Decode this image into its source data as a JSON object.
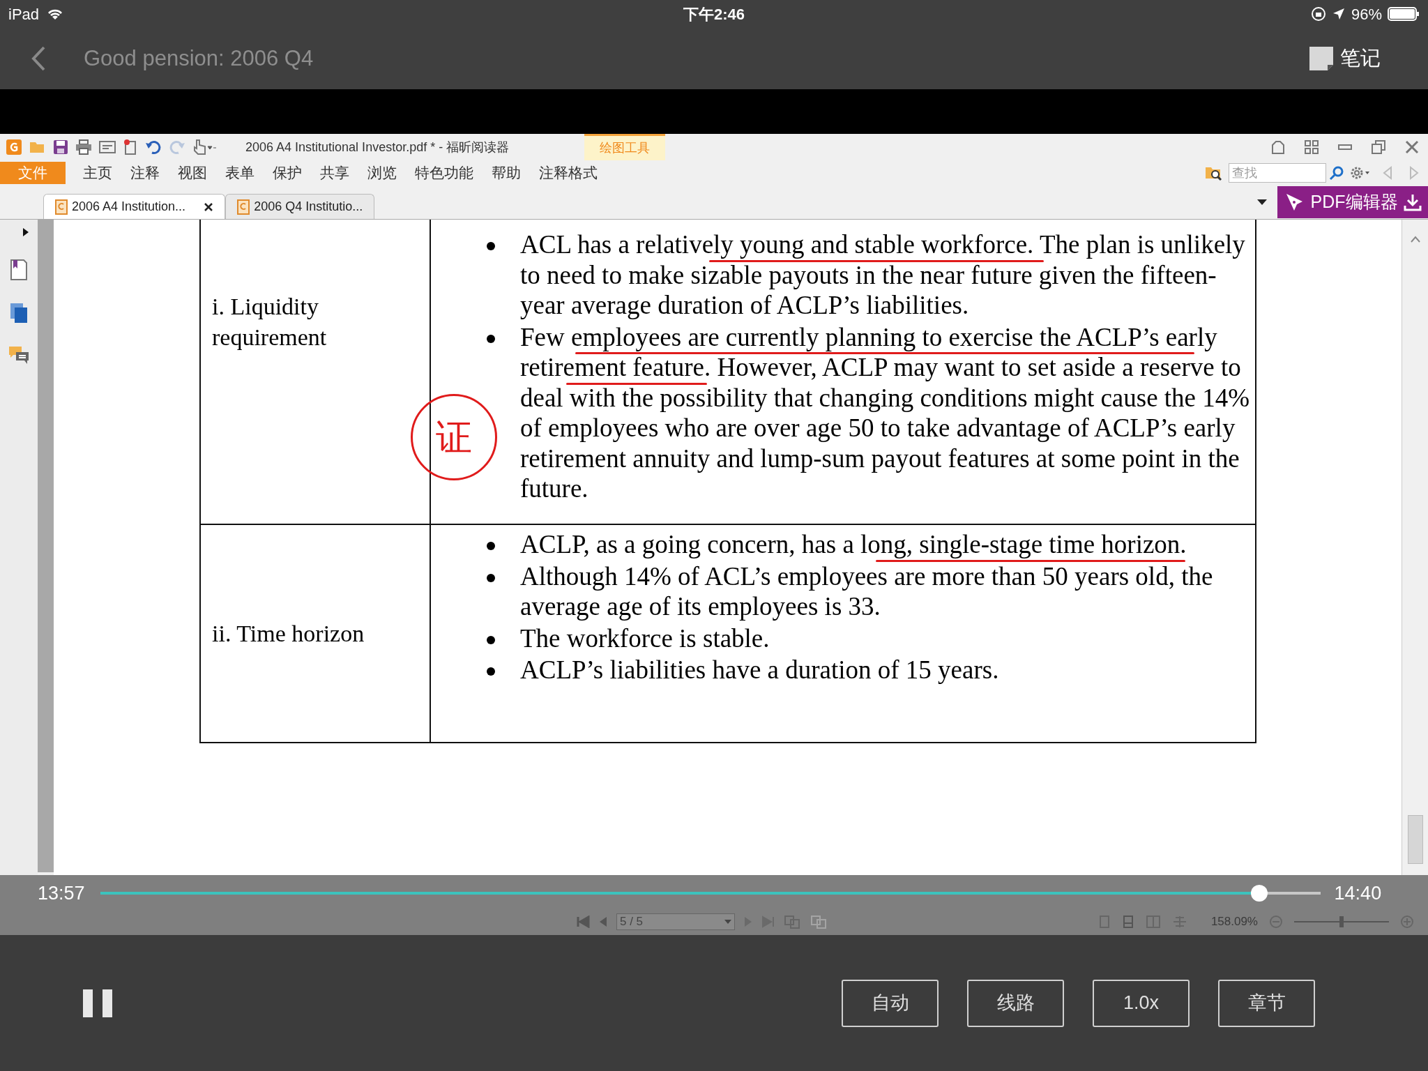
{
  "status_bar": {
    "device": "iPad",
    "time": "下午2:46",
    "battery": "96%"
  },
  "nav": {
    "title": "Good pension: 2006 Q4",
    "notes_button": "笔记"
  },
  "reader": {
    "title": "2006 A4 Institutional Investor.pdf * - 福昕阅读器",
    "context_tab": "绘图工具",
    "menu": [
      {
        "label": "文件",
        "selected": true
      },
      {
        "label": "主页",
        "selected": false
      },
      {
        "label": "注释",
        "selected": false
      },
      {
        "label": "视图",
        "selected": false
      },
      {
        "label": "表单",
        "selected": false
      },
      {
        "label": "保护",
        "selected": false
      },
      {
        "label": "共享",
        "selected": false
      },
      {
        "label": "浏览",
        "selected": false
      },
      {
        "label": "特色功能",
        "selected": false
      },
      {
        "label": "帮助",
        "selected": false
      },
      {
        "label": "注释格式",
        "selected": false
      }
    ],
    "search": {
      "placeholder": "查找"
    },
    "doc_tabs": [
      {
        "label": "2006 A4 Institution...",
        "selected": true
      },
      {
        "label": "2006 Q4 Institutio...",
        "selected": false
      }
    ],
    "editor_button": "PDF编辑器",
    "table": {
      "rows": [
        {
          "heading": "i. Liquidity requirement",
          "bullets": [
            "ACL has a relatively young and stable workforce.  The plan is unlikely to need to make sizable payouts in the near future given the fifteen-year average duration of ACLP’s liabilities.",
            "Few employees are currently planning to exercise the ACLP’s early retirement feature.  However, ACLP may want to set aside a reserve to deal with the possibility that changing conditions might cause the 14% of employees who are over age 50 to take advantage of ACLP’s early retirement annuity and lump-sum payout features at some point in the future."
          ]
        },
        {
          "heading": "ii. Time horizon",
          "bullets": [
            "ACLP, as a going concern, has a long, single-stage time horizon.",
            "Although 14% of ACL’s employees are more than 50 years old, the average age of its employees is 33.",
            "The workforce is stable.",
            "ACLP’s liabilities have a duration of 15 years."
          ]
        }
      ]
    },
    "margin_note": "证",
    "page_field": "5 / 5",
    "zoom": "158.09%",
    "zoom_slider": {
      "level": 0.5
    }
  },
  "player": {
    "elapsed": "13:57",
    "remaining": "14:40",
    "level": 0.95,
    "playing": true,
    "buttons": [
      "自动",
      "线路",
      "1.0x",
      "章节"
    ]
  }
}
